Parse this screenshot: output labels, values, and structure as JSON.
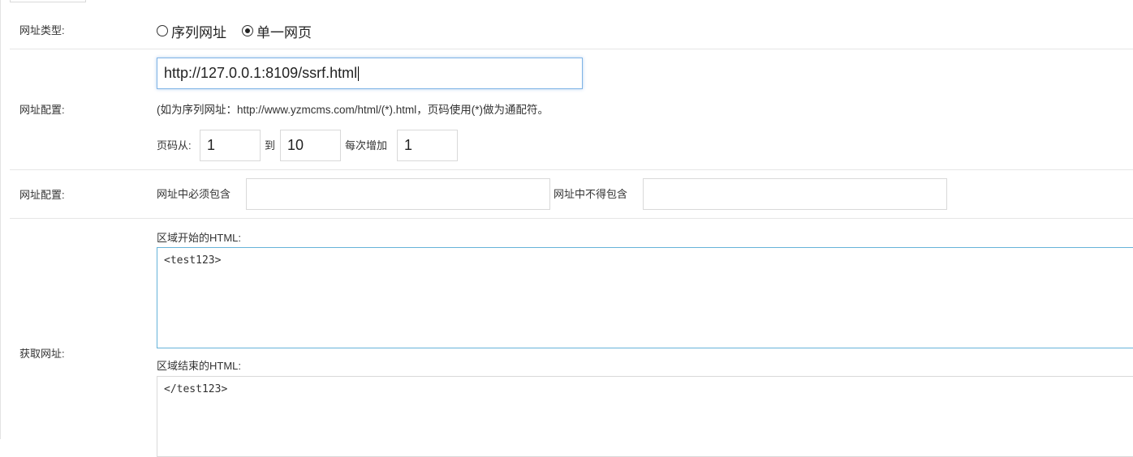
{
  "url_type": {
    "label": "网址类型:",
    "options": [
      {
        "label": "序列网址",
        "checked": false
      },
      {
        "label": "单一网页",
        "checked": true
      }
    ]
  },
  "url_config": {
    "label": "网址配置:",
    "url_value": "http://127.0.0.1:8109/ssrf.html",
    "hint": "(如为序列网址：http://www.yzmcms.com/html/(*).html，页码使用(*)做为通配符。",
    "page_from_label": "页码从:",
    "page_from_value": "1",
    "page_to_label": "到",
    "page_to_value": "10",
    "step_label": "每次增加",
    "step_value": "1"
  },
  "url_filter": {
    "label": "网址配置:",
    "must_include_label": "网址中必须包含",
    "must_include_value": "",
    "must_exclude_label": "网址中不得包含",
    "must_exclude_value": ""
  },
  "fetch_url": {
    "label": "获取网址:",
    "start_html_label": "区域开始的HTML:",
    "start_html_value": "<test123>",
    "end_html_label": "区域结束的HTML:",
    "end_html_value": "</test123>"
  }
}
